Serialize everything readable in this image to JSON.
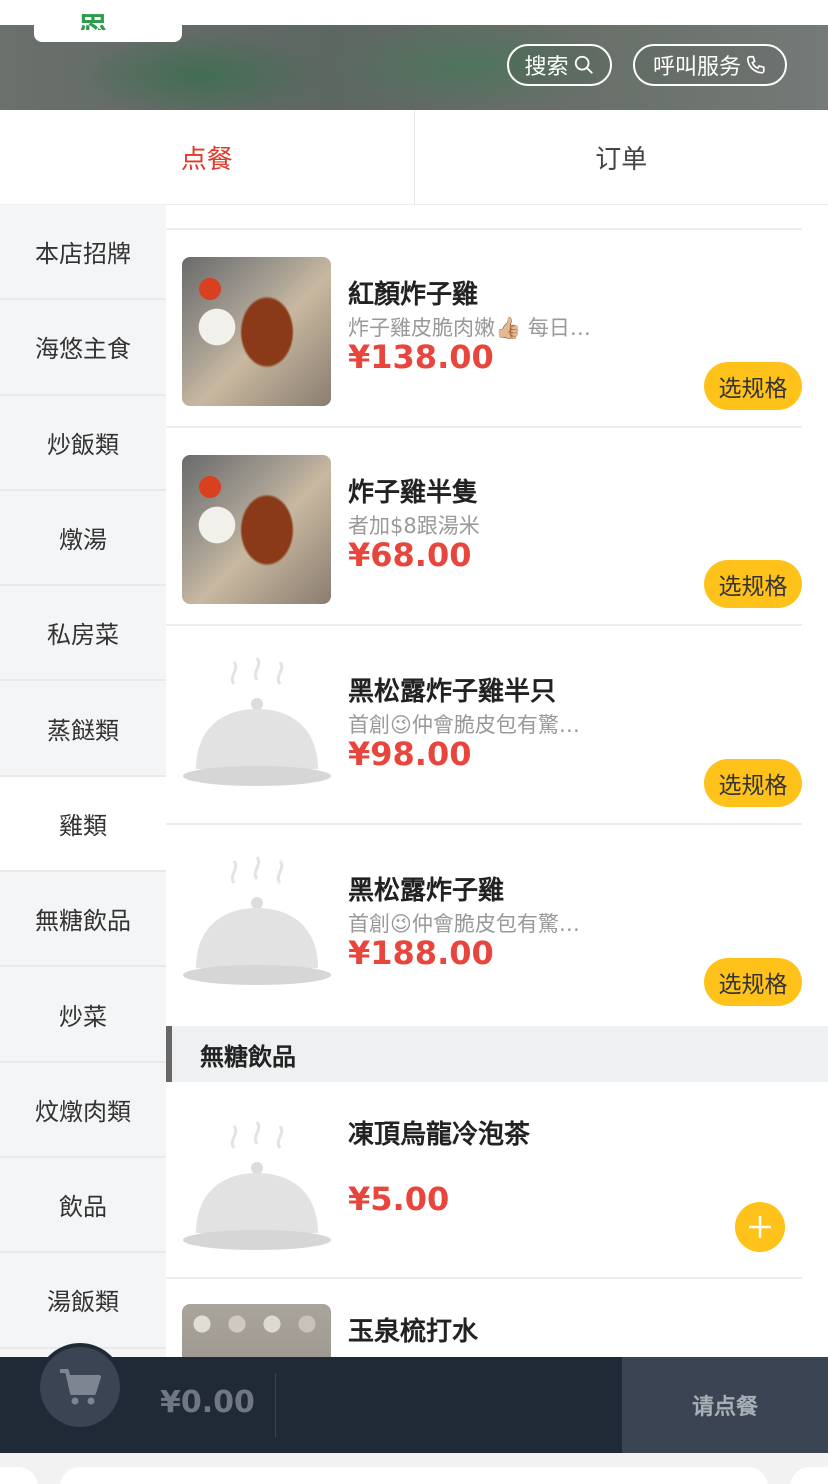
{
  "header": {
    "search_label": "搜索",
    "call_label": "呼叫服务"
  },
  "tabs": [
    {
      "label": "点餐",
      "active": true
    },
    {
      "label": "订单",
      "active": false
    }
  ],
  "sidebar": {
    "items": [
      {
        "label": "本店招牌"
      },
      {
        "label": "海悠主食"
      },
      {
        "label": "炒飯類"
      },
      {
        "label": "燉湯"
      },
      {
        "label": "私房菜"
      },
      {
        "label": "蒸餸類"
      },
      {
        "label": "雞類",
        "active": true
      },
      {
        "label": "無糖飲品"
      },
      {
        "label": "炒菜"
      },
      {
        "label": "炆燉肉類"
      },
      {
        "label": "飲品"
      },
      {
        "label": "湯飯類"
      }
    ]
  },
  "menu": {
    "spec_label": "选规格",
    "items": [
      {
        "name": "紅顏炸子雞",
        "desc": "炸子雞皮脆肉嫩👍🏼 每日…",
        "price": "¥138.00",
        "image": "photo"
      },
      {
        "name": "炸子雞半隻",
        "desc": "者加$8跟湯米",
        "price": "¥68.00",
        "image": "photo"
      },
      {
        "name": "黑松露炸子雞半只",
        "desc": "首創😉仲會脆皮包有驚…",
        "price": "¥98.00",
        "image": "placeholder-cloche-icon"
      },
      {
        "name": "黑松露炸子雞",
        "desc": "首創😉仲會脆皮包有驚…",
        "price": "¥188.00",
        "image": "placeholder-cloche-icon"
      }
    ],
    "section": {
      "title": "無糖飲品",
      "items": [
        {
          "name": "凍頂烏龍冷泡茶",
          "price": "¥5.00",
          "image": "placeholder-cloche-icon"
        },
        {
          "name": "玉泉梳打水",
          "image": "photo"
        }
      ]
    }
  },
  "cart": {
    "total": "¥0.00",
    "order_label": "请点餐"
  },
  "colors": {
    "accent_red": "#e8453c",
    "tab_active": "#e03a2b",
    "button_yellow": "#ffc21a",
    "cart_bar": "#202a36"
  }
}
